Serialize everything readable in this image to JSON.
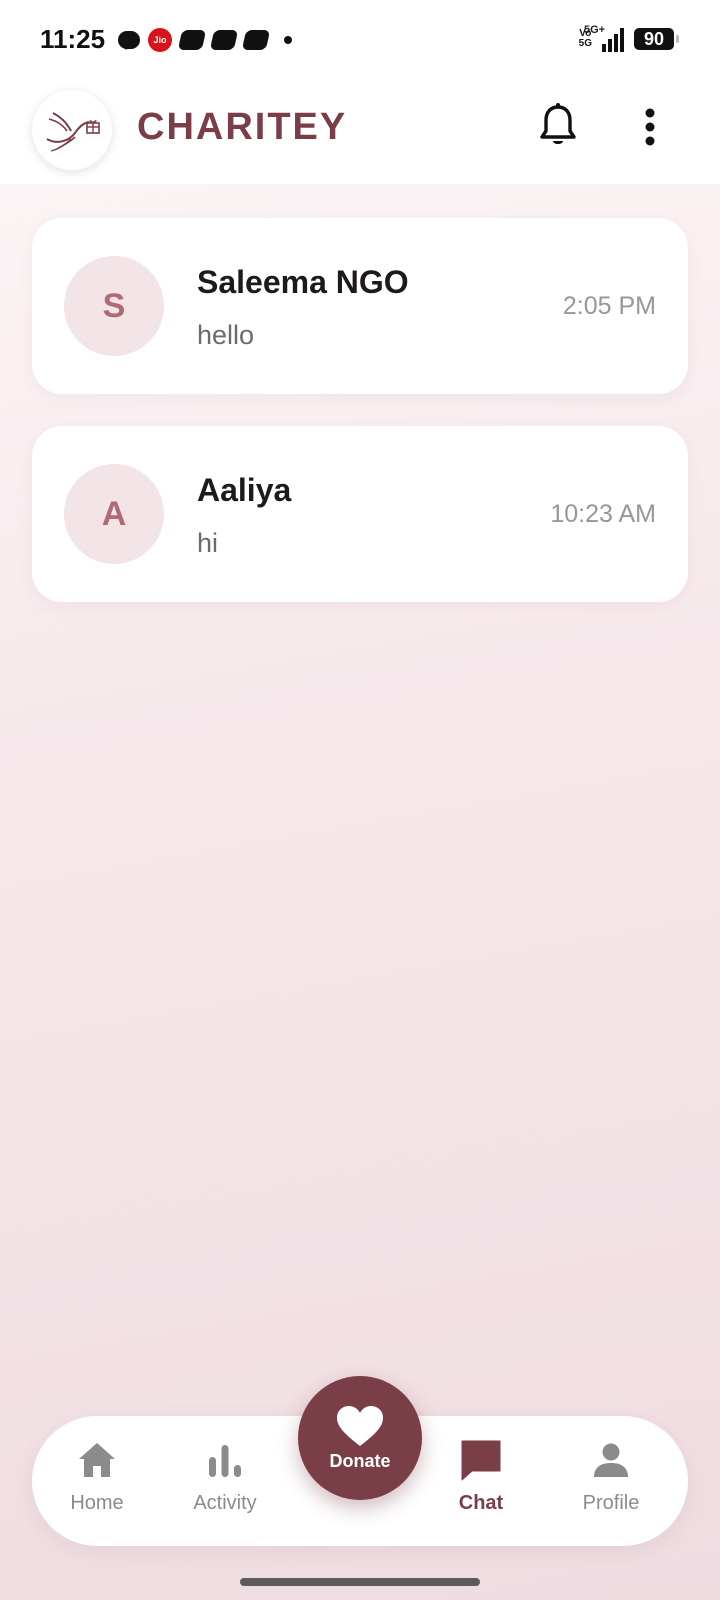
{
  "status_bar": {
    "time": "11:25",
    "jio_label": "Jio",
    "volte_top": "Vo",
    "volte_bottom": "5G",
    "network": "5G+",
    "battery": "90"
  },
  "app_bar": {
    "title": "CHARITEY",
    "logo_icon": "dove-gift-logo",
    "notification_icon": "bell-icon",
    "menu_icon": "more-vertical-icon"
  },
  "chats": [
    {
      "initial": "S",
      "name": "Saleema NGO",
      "preview": "hello",
      "time": "2:05 PM"
    },
    {
      "initial": "A",
      "name": "Aaliya",
      "preview": "hi",
      "time": "10:23 AM"
    }
  ],
  "bottom_nav": {
    "items": [
      {
        "label": "Home",
        "icon": "home-icon"
      },
      {
        "label": "Activity",
        "icon": "bar-chart-icon"
      },
      {
        "label": "Chat",
        "icon": "chat-icon",
        "active": true
      },
      {
        "label": "Profile",
        "icon": "person-icon"
      }
    ],
    "donate": {
      "label": "Donate",
      "icon": "heart-icon"
    }
  },
  "colors": {
    "brand": "#7a3e48",
    "avatar_bg": "#f3e4e7",
    "avatar_text": "#b06a74",
    "inactive": "#8d8a8b"
  }
}
